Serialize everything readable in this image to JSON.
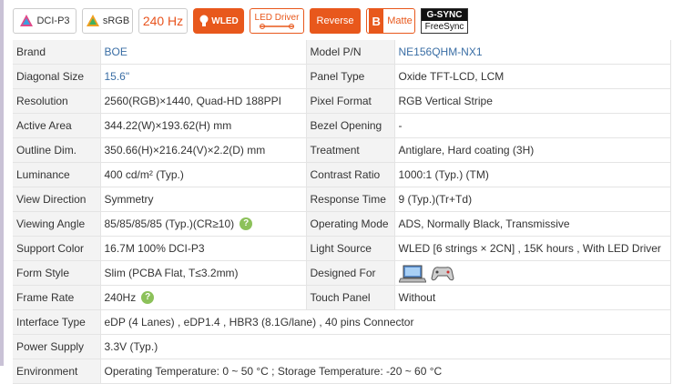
{
  "badges": {
    "dci": "DCI-P3",
    "srgb": "sRGB",
    "refresh": "240 Hz",
    "wled": "WLED",
    "led_driver": "LED Driver",
    "reverse": "Reverse",
    "matte": "Matte",
    "gsync_top": "G-SYNC",
    "gsync_bottom": "FreeSync"
  },
  "rows": [
    {
      "l1": "Brand",
      "v1": "BOE",
      "l2": "Model P/N",
      "v2": "NE156QHM-NX1"
    },
    {
      "l1": "Diagonal Size",
      "v1": "15.6\"",
      "l2": "Panel Type",
      "v2": "Oxide TFT-LCD, LCM"
    },
    {
      "l1": "Resolution",
      "v1": "2560(RGB)×1440, Quad-HD  188PPI",
      "l2": "Pixel Format",
      "v2": "RGB Vertical Stripe"
    },
    {
      "l1": "Active Area",
      "v1": "344.22(W)×193.62(H) mm",
      "l2": "Bezel Opening",
      "v2": "-"
    },
    {
      "l1": "Outline Dim.",
      "v1": "350.66(H)×216.24(V)×2.2(D) mm",
      "l2": "Treatment",
      "v2": "Antiglare, Hard coating (3H)"
    },
    {
      "l1": "Luminance",
      "v1": "400 cd/m² (Typ.)",
      "l2": "Contrast Ratio",
      "v2": "1000:1 (Typ.) (TM)"
    },
    {
      "l1": "View Direction",
      "v1": "Symmetry",
      "l2": "Response Time",
      "v2": "9 (Typ.)(Tr+Td)"
    },
    {
      "l1": "Viewing Angle",
      "v1": "85/85/85/85 (Typ.)(CR≥10)",
      "l2": "Operating Mode",
      "v2": "ADS, Normally Black, Transmissive"
    },
    {
      "l1": "Support Color",
      "v1": "16.7M   100% DCI-P3",
      "l2": "Light Source",
      "v2": "WLED  [6 strings × 2CN] , 15K hours , With LED Driver"
    },
    {
      "l1": "Form Style",
      "v1": "Slim (PCBA Flat, T≤3.2mm)",
      "l2": "Designed For",
      "v2": ""
    },
    {
      "l1": "Frame Rate",
      "v1": "240Hz",
      "l2": "Touch Panel",
      "v2": "Without"
    }
  ],
  "wide_rows": [
    {
      "label": "Interface Type",
      "value": "eDP (4 Lanes) , eDP1.4 , HBR3 (8.1G/lane) , 40 pins Connector"
    },
    {
      "label": "Power Supply",
      "value": "3.3V (Typ.)"
    },
    {
      "label": "Environment",
      "value": "Operating Temperature: 0 ~ 50 °C ; Storage Temperature: -20 ~ 60 °C"
    }
  ],
  "help_glyph": "?",
  "colors": {
    "accent": "#e8581c",
    "link": "#3a6ea5",
    "help": "#8cc15a"
  }
}
